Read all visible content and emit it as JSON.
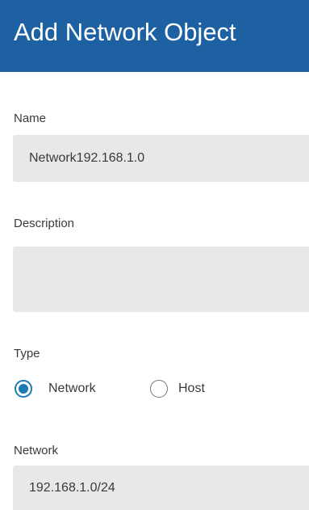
{
  "header": {
    "title": "Add Network Object"
  },
  "form": {
    "name": {
      "label": "Name",
      "value": "Network192.168.1.0"
    },
    "description": {
      "label": "Description",
      "value": ""
    },
    "type": {
      "label": "Type",
      "options": [
        {
          "label": "Network",
          "selected": true
        },
        {
          "label": "Host",
          "selected": false
        }
      ]
    },
    "network": {
      "label": "Network",
      "value": "192.168.1.0/24"
    }
  },
  "colors": {
    "header_bg": "#1d61a2",
    "field_bg": "#e8e8e8",
    "radio_accent": "#1d7ab8"
  }
}
